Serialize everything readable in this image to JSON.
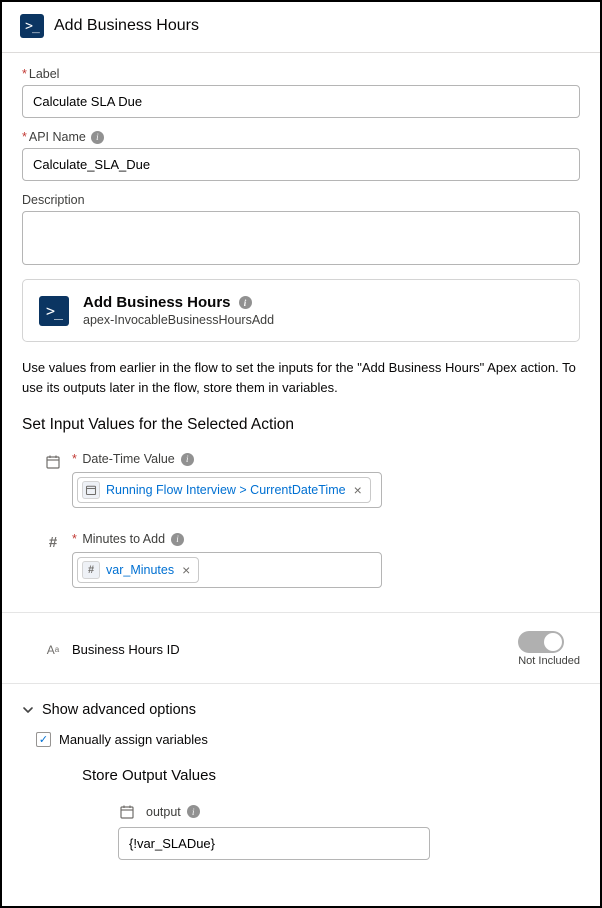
{
  "header": {
    "title": "Add Business Hours"
  },
  "fields": {
    "label": {
      "label": "Label",
      "value": "Calculate SLA Due"
    },
    "apiName": {
      "label": "API Name",
      "value": "Calculate_SLA_Due"
    },
    "description": {
      "label": "Description",
      "value": ""
    }
  },
  "actionCard": {
    "title": "Add Business Hours",
    "subtitle": "apex-InvocableBusinessHoursAdd"
  },
  "helpText": "Use values from earlier in the flow to set the inputs for the \"Add Business Hours\" Apex action. To use its outputs later in the flow, store them in variables.",
  "sectionHeading": "Set Input Values for the Selected Action",
  "inputs": {
    "dateTime": {
      "label": "Date-Time Value",
      "pill": "Running Flow Interview > CurrentDateTime"
    },
    "minutes": {
      "label": "Minutes to Add",
      "pill": "var_Minutes"
    },
    "businessHoursId": {
      "label": "Business Hours ID",
      "toggleState": "Not Included"
    }
  },
  "advanced": {
    "toggleLabel": "Show advanced options",
    "checkbox": "Manually assign variables",
    "outputHeading": "Store Output Values",
    "output": {
      "label": "output",
      "value": "{!var_SLADue}"
    }
  }
}
